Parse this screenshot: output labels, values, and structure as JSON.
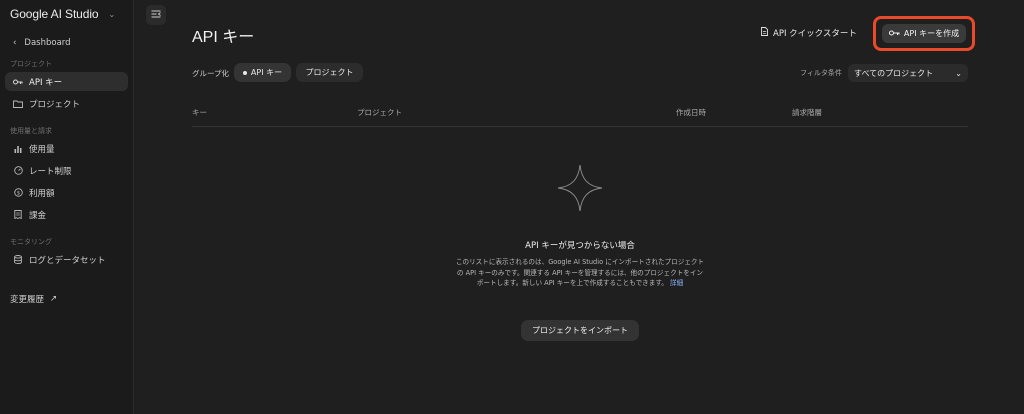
{
  "sidebar": {
    "brand": "Google AI Studio",
    "back_label": "Dashboard",
    "sections": {
      "project": "プロジェクト",
      "usage": "使用量と請求",
      "monitoring": "モニタリング"
    },
    "items": {
      "api_keys": "API キー",
      "projects": "プロジェクト",
      "usage": "使用量",
      "rate_limit": "レート制限",
      "spend": "利用額",
      "billing": "課金",
      "logs": "ログとデータセット"
    },
    "changelog": "変更履歴"
  },
  "header": {
    "title": "API キー",
    "quickstart": "API クイックスタート",
    "create_key": "API キーを作成"
  },
  "filters": {
    "group_by_label": "グループ化",
    "chip_keys": "API キー",
    "chip_projects": "プロジェクト",
    "filter_label": "フィルタ条件",
    "filter_value": "すべてのプロジェクト"
  },
  "table": {
    "columns": [
      "キー",
      "プロジェクト",
      "作成日時",
      "請求階層"
    ]
  },
  "empty_state": {
    "title": "API キーが見つからない場合",
    "description": "このリストに表示されるのは、Google AI Studio にインポートされたプロジェクトの API キーのみです。関連する API キーを管理するには、他のプロジェクトをインポートします。新しい API キーを上で作成することもできます。",
    "more_link": "詳細",
    "import_button": "プロジェクトをインポート"
  },
  "colors": {
    "highlight": "#e94a2a",
    "link": "#8ab4f8",
    "background": "#1f1f1f"
  }
}
